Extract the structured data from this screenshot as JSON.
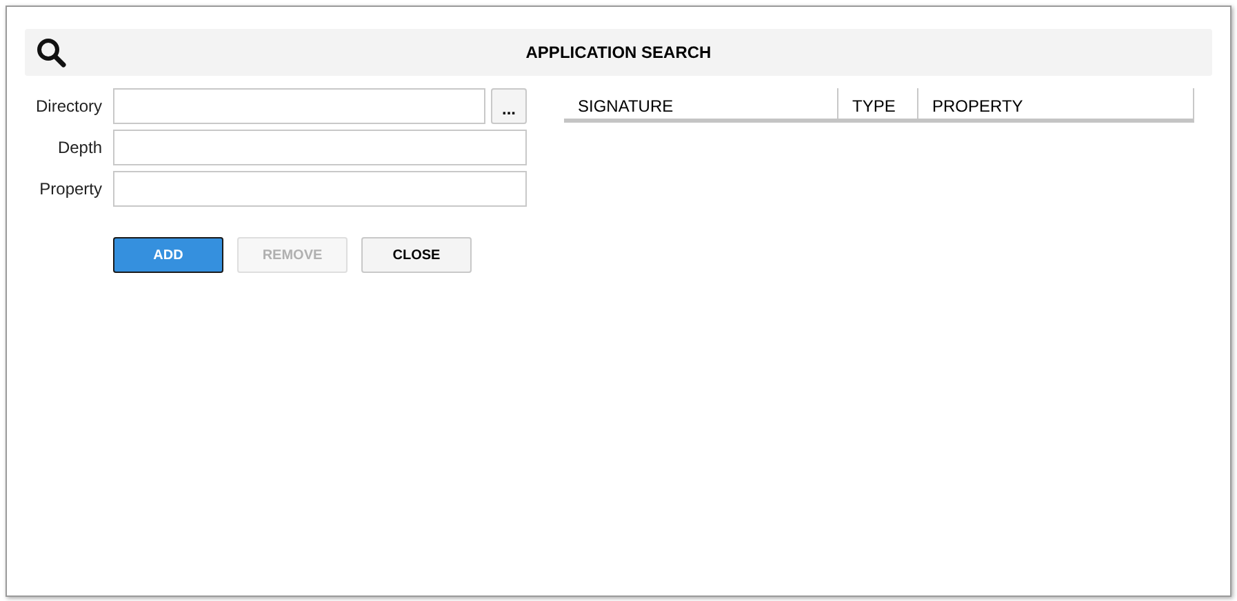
{
  "header": {
    "title": "APPLICATION SEARCH"
  },
  "form": {
    "fields": [
      {
        "label": "Directory",
        "browse": "..."
      },
      {
        "label": "Depth"
      },
      {
        "label": "Property"
      }
    ]
  },
  "buttons": [
    {
      "label": "ADD",
      "kind": "primary",
      "disabled": false
    },
    {
      "label": "REMOVE",
      "kind": "default",
      "disabled": true
    },
    {
      "label": "CLOSE",
      "kind": "default",
      "disabled": false
    }
  ],
  "table": {
    "columns": [
      "SIGNATURE",
      "TYPE",
      "PROPERTY"
    ]
  }
}
